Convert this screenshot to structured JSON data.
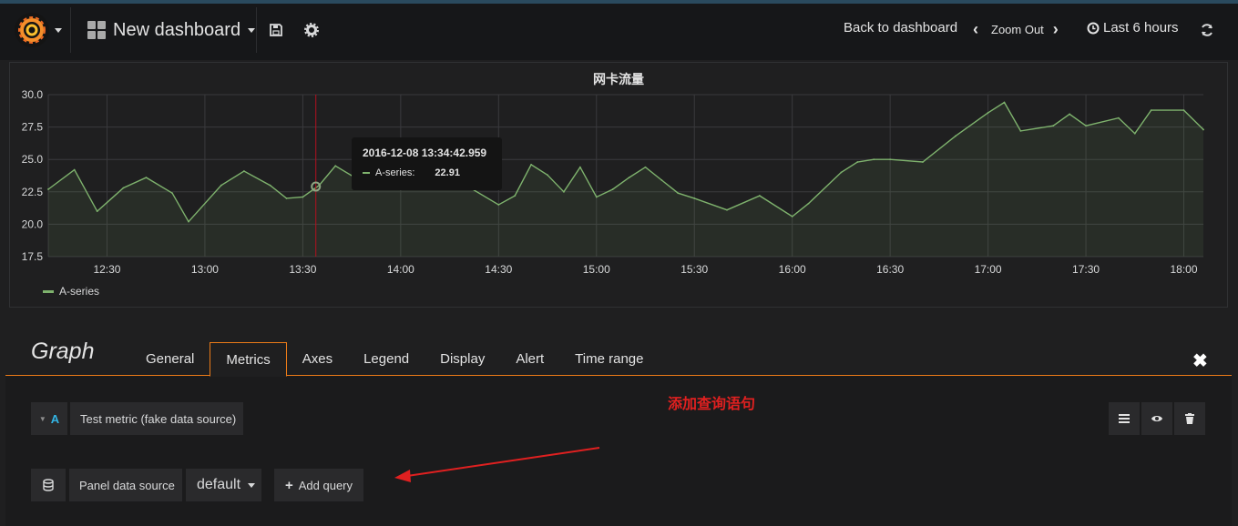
{
  "toolbar": {
    "dashboard_title": "New dashboard",
    "back_label": "Back to dashboard",
    "zoom_label": "Zoom Out",
    "time_range_label": "Last 6 hours"
  },
  "panel": {
    "title": "网卡流量",
    "legend_label": "A-series",
    "tooltip": {
      "time": "2016-12-08 13:34:42.959",
      "series": "A-series:",
      "value": "22.91"
    }
  },
  "chart_data": {
    "type": "line",
    "title": "网卡流量",
    "x_ticks": [
      "12:30",
      "13:00",
      "13:30",
      "14:00",
      "14:30",
      "15:00",
      "15:30",
      "16:00",
      "16:30",
      "17:00",
      "17:30",
      "18:00"
    ],
    "y_ticks": [
      "30.0",
      "27.5",
      "25.0",
      "22.5",
      "20.0",
      "17.5"
    ],
    "ylim": [
      17.5,
      30.0
    ],
    "xlim": [
      "12:12",
      "18:06"
    ],
    "grid": true,
    "legend": "bottom-left",
    "series": [
      {
        "name": "A-series",
        "color": "#7eb26d",
        "x": [
          "12:12",
          "12:20",
          "12:27",
          "12:35",
          "12:42",
          "12:50",
          "12:55",
          "13:05",
          "13:12",
          "13:20",
          "13:25",
          "13:30",
          "13:35",
          "13:40",
          "13:50",
          "14:00",
          "14:10",
          "14:20",
          "14:30",
          "14:35",
          "14:40",
          "14:45",
          "14:50",
          "14:55",
          "15:00",
          "15:05",
          "15:10",
          "15:15",
          "15:20",
          "15:25",
          "15:30",
          "15:40",
          "15:50",
          "16:00",
          "16:05",
          "16:15",
          "16:20",
          "16:25",
          "16:30",
          "16:40",
          "16:50",
          "17:00",
          "17:05",
          "17:10",
          "17:20",
          "17:25",
          "17:30",
          "17:40",
          "17:45",
          "17:50",
          "18:00",
          "18:06"
        ],
        "y": [
          22.7,
          24.2,
          21.0,
          22.8,
          23.6,
          22.4,
          20.2,
          23.0,
          24.1,
          23.0,
          22.0,
          22.1,
          23.0,
          24.5,
          23.0,
          25.0,
          23.5,
          23.0,
          21.5,
          22.2,
          24.6,
          23.8,
          22.5,
          24.4,
          22.1,
          22.7,
          23.6,
          24.4,
          23.4,
          22.4,
          22.0,
          21.1,
          22.2,
          20.6,
          21.6,
          24.0,
          24.8,
          25.0,
          25.0,
          24.8,
          26.8,
          28.6,
          29.4,
          27.2,
          27.6,
          28.5,
          27.6,
          28.2,
          27.0,
          28.8,
          28.8,
          27.3
        ]
      }
    ],
    "crosshair_x": "13:34"
  },
  "editor": {
    "title": "Graph",
    "tabs": [
      "General",
      "Metrics",
      "Axes",
      "Legend",
      "Display",
      "Alert",
      "Time range"
    ],
    "active_tab": "Metrics",
    "query": {
      "ref_id": "A",
      "label": "Test metric (fake data source)"
    },
    "datasource_label": "Panel data source",
    "datasource_value": "default",
    "add_query_label": "Add query",
    "annotation_text": "添加查询语句"
  },
  "colors": {
    "accent": "#eb7b18",
    "series": "#7eb26d",
    "annotation": "#e02020",
    "crosshair": "#b3101f"
  }
}
